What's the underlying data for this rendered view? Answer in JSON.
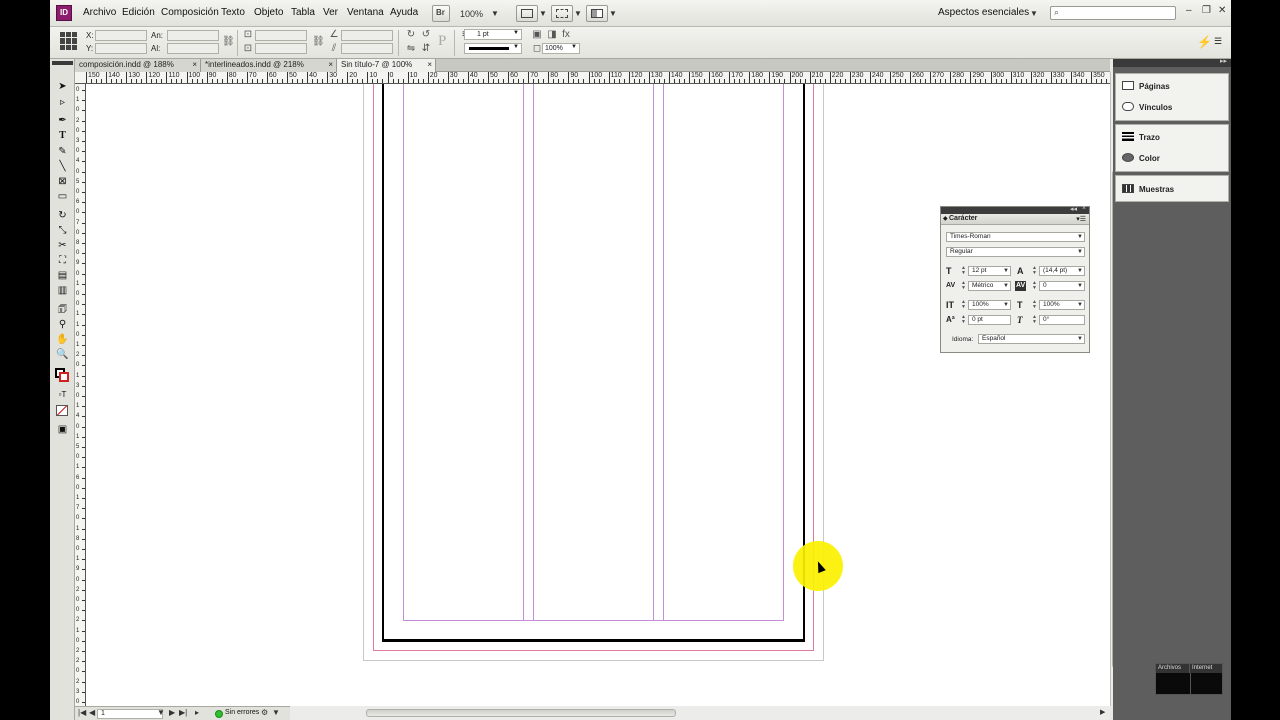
{
  "app": {
    "logo_text": "ID",
    "menu": [
      "Archivo",
      "Edición",
      "Composición",
      "Texto",
      "Objeto",
      "Tabla",
      "Ver",
      "Ventana",
      "Ayuda"
    ],
    "zoom": "100%",
    "workspace": "Aspectos esenciales",
    "search_placeholder": ""
  },
  "control_panel": {
    "x_label": "X:",
    "y_label": "Y:",
    "w_label": "An:",
    "h_label": "Al:",
    "stroke_weight": "1 pt",
    "opacity": "100%"
  },
  "tabs": [
    {
      "label": "composición.indd @ 188%",
      "active": false
    },
    {
      "label": "*interlineados.indd @ 218%",
      "active": false
    },
    {
      "label": "Sin título-7 @ 100%",
      "active": true
    }
  ],
  "ruler": {
    "top_labels": [
      "150",
      "140",
      "130",
      "120",
      "110",
      "100",
      "90",
      "80",
      "70",
      "60",
      "50",
      "40",
      "30",
      "20",
      "10",
      "0",
      "10",
      "20",
      "30",
      "40",
      "50",
      "60",
      "70",
      "80",
      "90",
      "100",
      "110",
      "120",
      "130",
      "140",
      "150",
      "160",
      "170",
      "180",
      "190",
      "200",
      "210",
      "220",
      "230",
      "240",
      "250",
      "260",
      "270",
      "280",
      "290",
      "300",
      "310",
      "320",
      "330",
      "340",
      "350"
    ],
    "left_labels": [
      "0",
      "1",
      "0",
      "2",
      "0",
      "3",
      "0",
      "4",
      "0",
      "5",
      "0",
      "6",
      "0",
      "7",
      "0",
      "8",
      "0",
      "9",
      "0",
      "1",
      "0",
      "0",
      "1",
      "1",
      "0",
      "1",
      "2",
      "0",
      "1",
      "3",
      "0",
      "1",
      "4",
      "0",
      "1",
      "5",
      "0",
      "1",
      "6",
      "0",
      "1",
      "7",
      "0",
      "1",
      "8",
      "0",
      "1",
      "9",
      "0",
      "2",
      "0",
      "0",
      "2",
      "1",
      "0",
      "2",
      "2",
      "0",
      "2",
      "3",
      "0"
    ]
  },
  "status_bar": {
    "page": "1",
    "preflight": "Sin errores"
  },
  "dock": {
    "groups": [
      {
        "items": [
          "Páginas",
          "Vínculos"
        ]
      },
      {
        "items": [
          "Trazo",
          "Color"
        ]
      },
      {
        "items": [
          "Muestras"
        ]
      }
    ]
  },
  "character_panel": {
    "title": "Carácter",
    "font_family": "Times-Roman",
    "font_style": "Regular",
    "font_size": "12 pt",
    "leading": "(14,4 pt)",
    "kerning": "Métrico",
    "tracking": "0",
    "vertical_scale": "100%",
    "horizontal_scale": "100%",
    "baseline_shift": "0 pt",
    "skew": "0°",
    "language_label": "Idioma:",
    "language": "Español"
  },
  "overlay": {
    "tab_a": "Archivos",
    "tab_b": "Internet"
  },
  "colors": {
    "accent": "#8c1d6e",
    "guide": "#c48fd8",
    "bleed": "#e07c9a",
    "cursor_highlight": "#fbf100",
    "preflight_ok": "#2fbf2f"
  }
}
